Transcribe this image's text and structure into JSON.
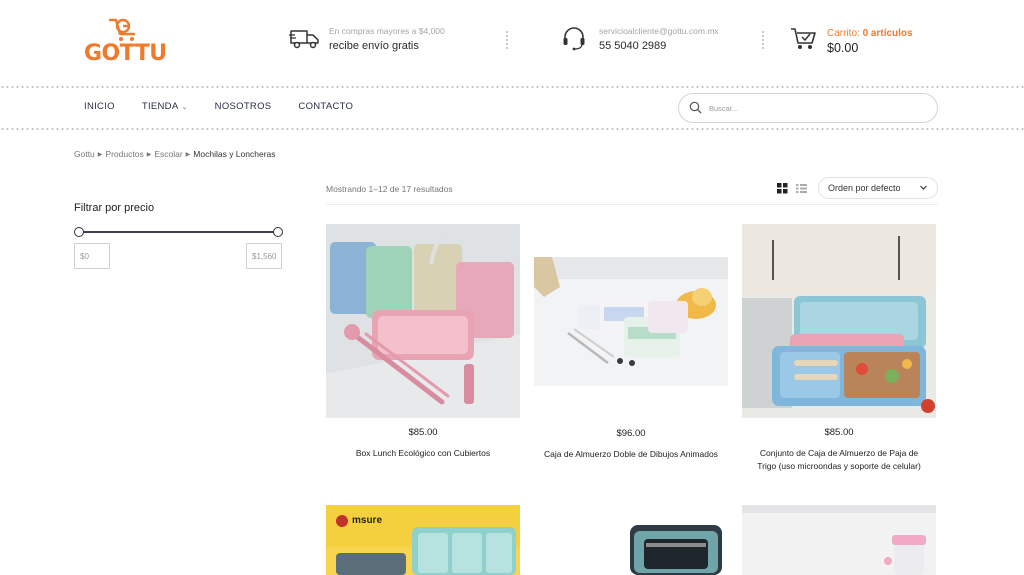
{
  "brand": {
    "logo_text": "GOTTU",
    "accent": "#f07a2c"
  },
  "header": {
    "shipping": {
      "small": "En compras mayores a $4,000",
      "big": "recibe envío gratis",
      "icon": "truck-icon"
    },
    "contact": {
      "small": "servicioalcliente@gottu.com.mx",
      "big": "55 5040 2989",
      "icon": "headset-icon"
    },
    "cart": {
      "label": "Carrito:",
      "count": "0 artículos",
      "total": "$0.00",
      "icon": "cart-icon"
    }
  },
  "nav": {
    "items": [
      {
        "label": "INICIO"
      },
      {
        "label": "TIENDA",
        "has_dropdown": true
      },
      {
        "label": "NOSOTROS"
      },
      {
        "label": "CONTACTO"
      }
    ]
  },
  "search": {
    "placeholder": "Buscar...",
    "value": ""
  },
  "breadcrumb": {
    "items": [
      "Gottu",
      "Productos",
      "Escolar"
    ],
    "current": "Mochilas y Loncheras"
  },
  "filter": {
    "title": "Filtrar por precio",
    "min": "$0",
    "max": "$1,560"
  },
  "results": {
    "text": "Mostrando 1–12 de 17 resultados",
    "order_label": "Orden por defecto"
  },
  "products": [
    {
      "price": "$85.00",
      "name": "Box Lunch Ecológico con Cubiertos"
    },
    {
      "price": "$96.00",
      "name": "Caja de Almuerzo Doble de Dibujos Animados"
    },
    {
      "price": "$85.00",
      "name": "Conjunto de Caja de Almuerzo de Paja de Trigo (uso microondas y soporte de celular)"
    }
  ],
  "row2_brand_label": "msure"
}
